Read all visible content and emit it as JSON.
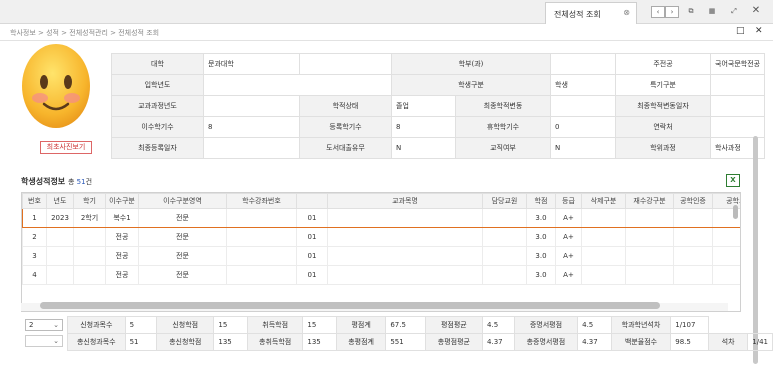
{
  "tab": {
    "title": "전체성적 조회"
  },
  "breadcrumb": "학사정보 > 성적 > 전체성적관리 > 전체성적 조회",
  "photo_button": "최초사진보기",
  "info_rows": [
    [
      {
        "l": "대학",
        "v": "문과대학"
      },
      {
        "l": "학부(과)",
        "v": ""
      },
      {
        "l": "주전공",
        "v": "국어국문학전공"
      }
    ],
    [
      {
        "l": "입학년도",
        "v": ""
      },
      {
        "l": "학생구분",
        "v": "학생"
      },
      {
        "l": "특기구분",
        "v": ""
      }
    ],
    [
      {
        "l": "교과과정년도",
        "v": ""
      },
      {
        "l": "학적상태",
        "v": "졸업"
      },
      {
        "l": "최종학적변동",
        "v": ""
      },
      {
        "l": "최종학적변동일자",
        "v": ""
      }
    ],
    [
      {
        "l": "이수학기수",
        "v": "8"
      },
      {
        "l": "등록학기수",
        "v": "8"
      },
      {
        "l": "휴학학기수",
        "v": "0"
      },
      {
        "l": "연락처",
        "v": ""
      }
    ],
    [
      {
        "l": "최종등록일자",
        "v": ""
      },
      {
        "l": "도서대출유무",
        "v": "N"
      },
      {
        "l": "교직여부",
        "v": "N"
      },
      {
        "l": "학위과정",
        "v": "학사과정"
      }
    ]
  ],
  "section": {
    "title": "학생성적정보",
    "count_prefix": "총",
    "count": "51",
    "count_suffix": "건"
  },
  "grid": {
    "headers": [
      "번호",
      "년도",
      "학기",
      "이수구분",
      "이수구분영역",
      "학수강좌번호",
      "",
      "교과목명",
      "담당교원",
      "학점",
      "등급",
      "삭제구분",
      "재수강구분",
      "공학인증",
      "공학요소"
    ],
    "rows": [
      [
        "1",
        "2023",
        "2학기",
        "복수1",
        "전문",
        "",
        "01",
        "",
        "",
        "3.0",
        "A+",
        "",
        "",
        "",
        ""
      ],
      [
        "2",
        "",
        "",
        "전공",
        "전문",
        "",
        "01",
        "",
        "",
        "3.0",
        "A+",
        "",
        "",
        "",
        ""
      ],
      [
        "3",
        "",
        "",
        "전공",
        "전문",
        "",
        "01",
        "",
        "",
        "3.0",
        "A+",
        "",
        "",
        "",
        ""
      ],
      [
        "4",
        "",
        "",
        "전공",
        "전문",
        "",
        "01",
        "",
        "",
        "3.0",
        "A+",
        "",
        "",
        "",
        ""
      ]
    ]
  },
  "summary": {
    "select1": "2",
    "select2": "",
    "row1": [
      {
        "l": "신청과목수",
        "v": "5"
      },
      {
        "l": "신청학점",
        "v": "15"
      },
      {
        "l": "취득학점",
        "v": "15"
      },
      {
        "l": "평점계",
        "v": "67.5"
      },
      {
        "l": "평점평균",
        "v": "4.5"
      },
      {
        "l": "증명서평점",
        "v": "4.5"
      },
      {
        "l": "학과학년석차",
        "v": "1/107"
      }
    ],
    "row2": [
      {
        "l": "총신청과목수",
        "v": "51"
      },
      {
        "l": "총신청학점",
        "v": "135"
      },
      {
        "l": "총취득학점",
        "v": "135"
      },
      {
        "l": "총평점계",
        "v": "551"
      },
      {
        "l": "총평점평균",
        "v": "4.37"
      },
      {
        "l": "총증명서평점",
        "v": "4.37"
      },
      {
        "l": "백분율점수",
        "v": "98.5"
      },
      {
        "l": "석차",
        "v": "1/41"
      }
    ]
  },
  "icons": {
    "excel": "X"
  },
  "colors": {
    "selected_row_border": "#e07020",
    "count_color": "#2a58b8"
  }
}
